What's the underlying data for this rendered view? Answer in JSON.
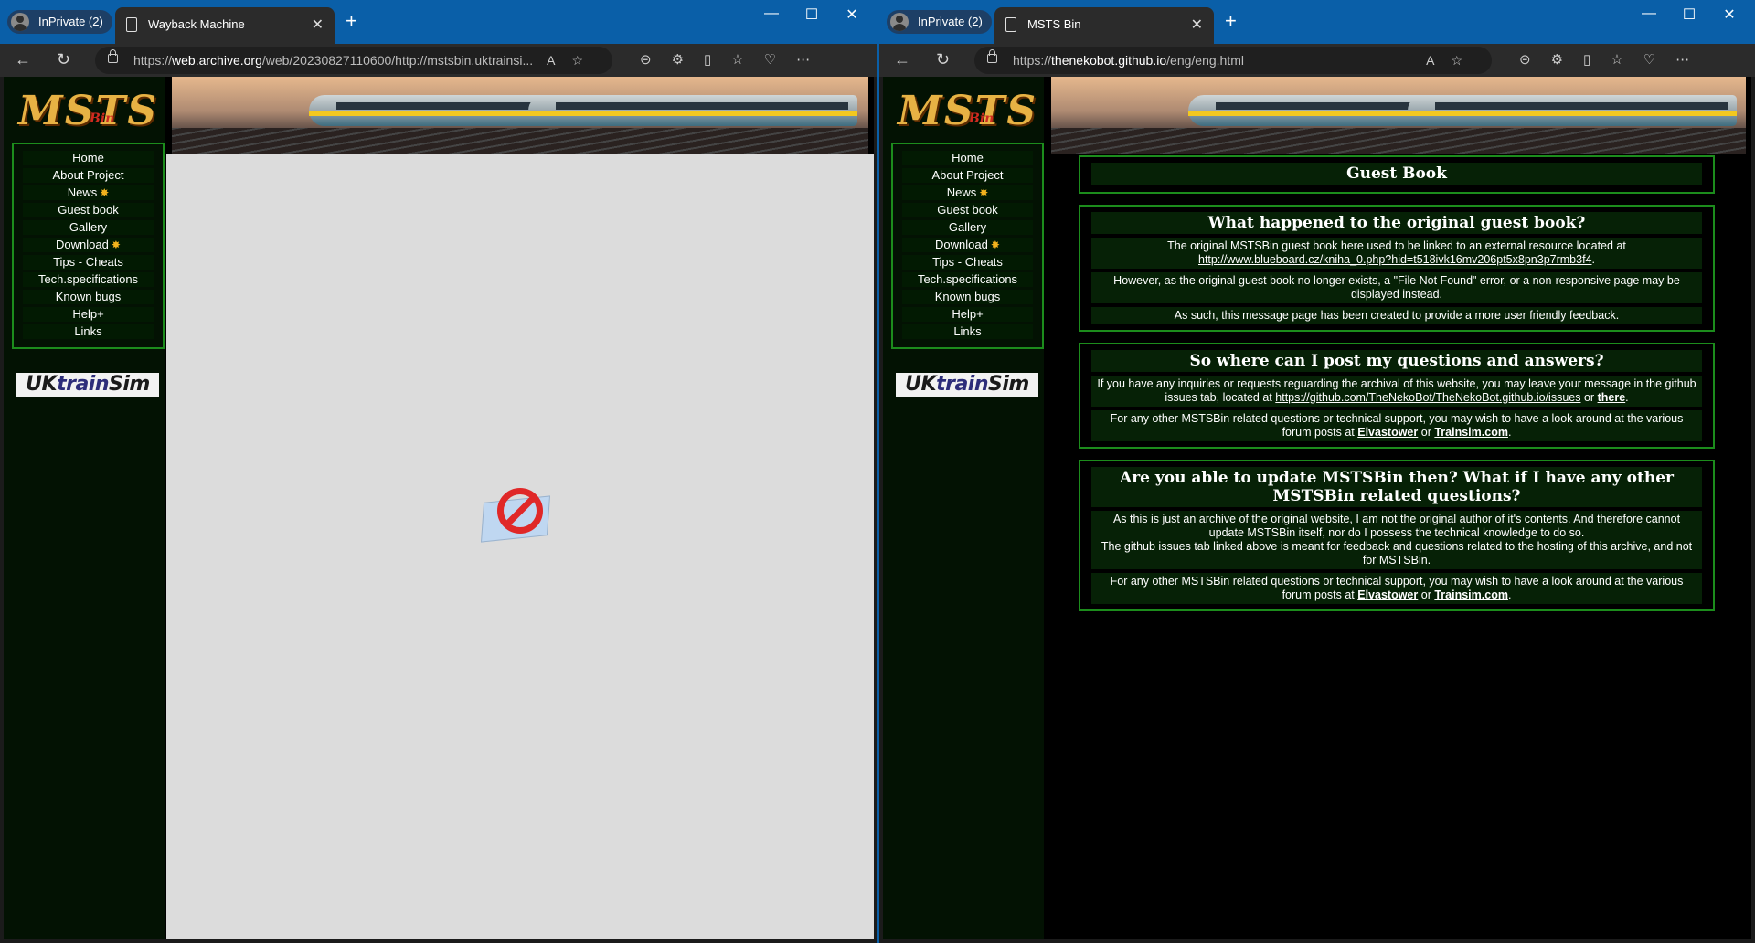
{
  "left_window": {
    "inprivate_label": "InPrivate (2)",
    "tab_title": "Wayback Machine",
    "url_prefix": "https://",
    "url_domain": "web.archive.org",
    "url_rest": "/web/20230827110600/http://mstsbin.uktrainsi...",
    "page_state": "blocked"
  },
  "right_window": {
    "inprivate_label": "InPrivate (2)",
    "tab_title": "MSTS Bin",
    "url_prefix": "https://",
    "url_domain": "thenekobot.github.io",
    "url_rest": "/eng/eng.html"
  },
  "site": {
    "logo_text": "MSTS",
    "logo_sub": "Bin",
    "menu": [
      {
        "label": "Home",
        "new": false
      },
      {
        "label": "About Project",
        "new": false
      },
      {
        "label": "News",
        "new": true
      },
      {
        "label": "Guest book",
        "new": false
      },
      {
        "label": "Gallery",
        "new": false
      },
      {
        "label": "Download",
        "new": true
      },
      {
        "label": "Tips - Cheats",
        "new": false
      },
      {
        "label": "Tech.specifications",
        "new": false
      },
      {
        "label": "Known bugs",
        "new": false
      },
      {
        "label": "Help+",
        "new": false
      },
      {
        "label": "Links",
        "new": false
      }
    ],
    "uktrain_uk": "UK",
    "uktrain_train": "train",
    "uktrain_sim": "Sim"
  },
  "guestbook": {
    "title": "Guest Book",
    "s1_heading": "What happened to the original guest book?",
    "s1_p1_text": "The original MSTSBin guest book here used to be linked to an external resource located at",
    "s1_p1_link": "http://www.blueboard.cz/kniha_0.php?hid=t518ivk16mv206pt5x8pn3p7rmb3f4",
    "s1_p2": "However, as the original guest book no longer exists, a \"File Not Found\" error, or a non-responsive page may be displayed instead.",
    "s1_p3": "As such, this message page has been created to provide a more user friendly feedback.",
    "s2_heading": "So where can I post my questions and answers?",
    "s2_p1_text": "If you have any inquiries or requests reguarding the archival of this website, you may leave your message in the github issues tab, located at",
    "s2_p1_link": "https://github.com/TheNekoBot/TheNekoBot.github.io/issues",
    "s2_p1_or": "or",
    "s2_p1_there": "there",
    "s2_p2_text": "For any other MSTSBin related questions or technical support, you may wish to have a look around at the various forum posts at",
    "link_elvastower": "Elvastower",
    "link_or": "or",
    "link_trainsim": "Trainsim.com",
    "s3_heading": "Are you able to update MSTSBin then? What if I have any other MSTSBin related questions?",
    "s3_p1a": "As this is just an archive of the original website, I am not the original author of it's contents. And therefore cannot update MSTSBin itself, nor do I possess the technical knowledge to do so.",
    "s3_p1b": "The github issues tab linked above is meant for feedback and questions related to the hosting of this archive, and not for MSTSBin.",
    "s3_p2_text": "For any other MSTSBin related questions or technical support, you may wish to have a look around at the various forum posts at"
  }
}
